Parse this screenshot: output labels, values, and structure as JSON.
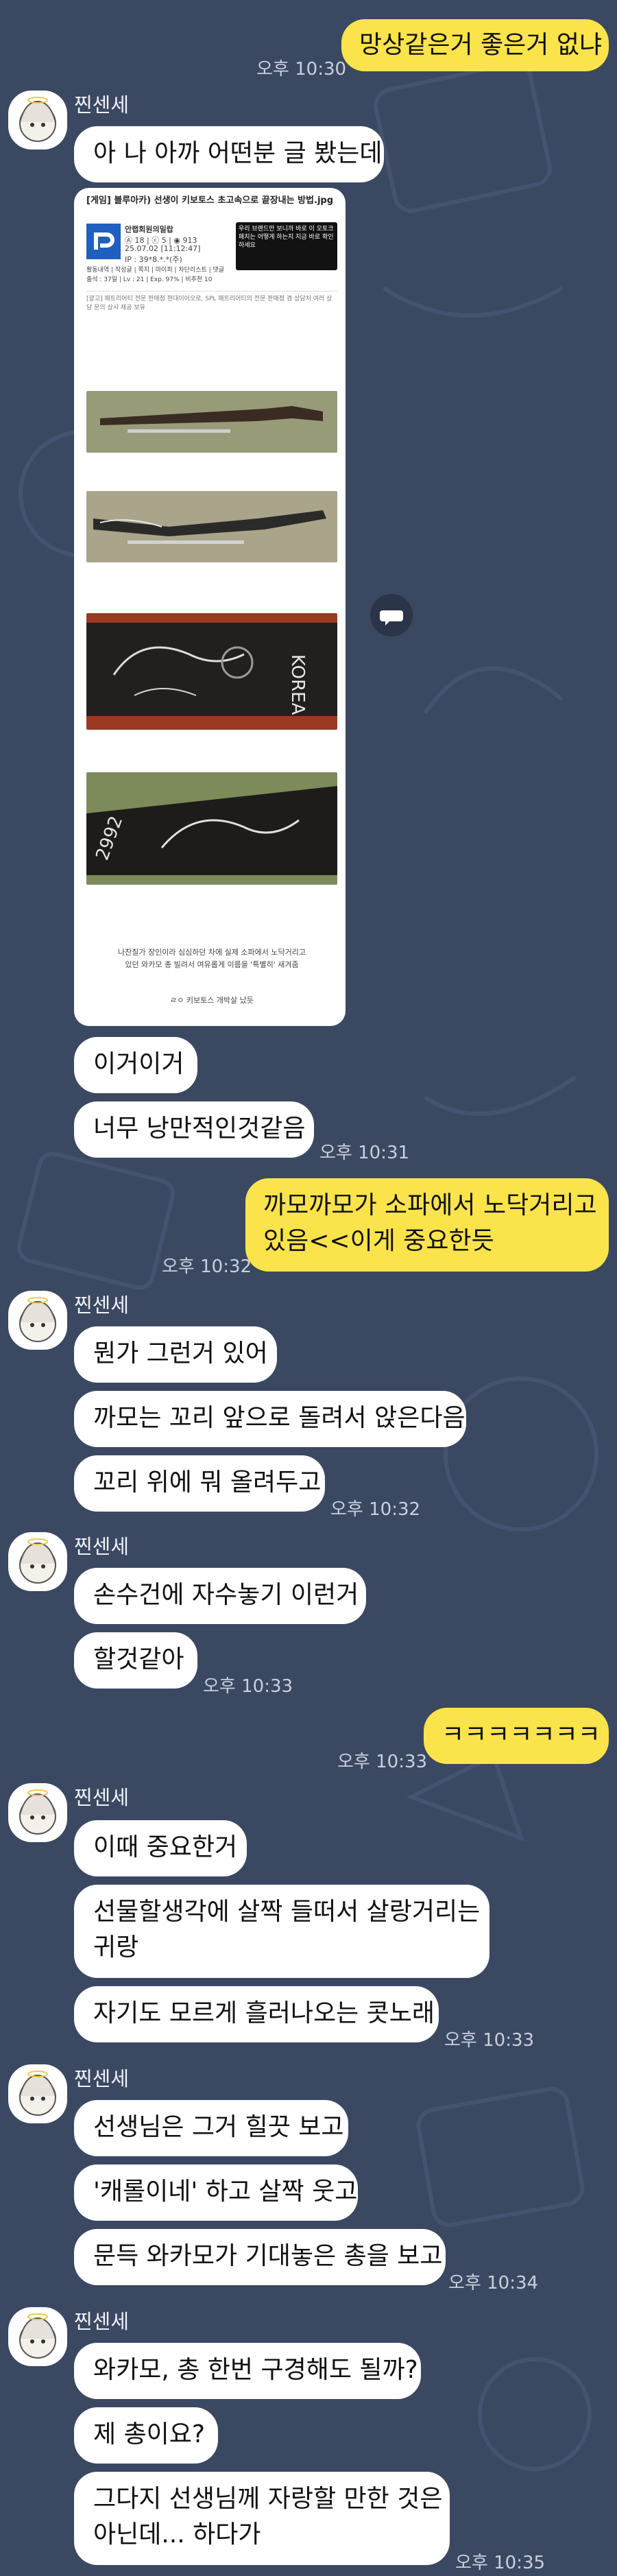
{
  "chat": {
    "contact_name": "찐센세",
    "colors": {
      "background": "#3b4862",
      "incoming": "#ffffff",
      "outgoing": "#fbe34c"
    }
  },
  "messages": [
    {
      "dir": "out",
      "text": "망상같은거 좋은거 없냐",
      "time": "오후 10:30"
    },
    {
      "dir": "in",
      "text": "아 나 아까 어떤분 글 봤는데"
    },
    {
      "dir": "in",
      "kind": "image"
    },
    {
      "dir": "in",
      "text": "이거이거"
    },
    {
      "dir": "in",
      "text": "너무 낭만적인것같음",
      "time": "오후 10:31"
    },
    {
      "dir": "out",
      "text": "까모까모가 소파에서 노닥거리고\n있음<<이게 중요한듯",
      "time": "오후 10:32"
    },
    {
      "dir": "in",
      "text": "뭔가 그런거 있어"
    },
    {
      "dir": "in",
      "text": "까모는 꼬리 앞으로 돌려서 앉은다음"
    },
    {
      "dir": "in",
      "text": "꼬리 위에 뭐 올려두고",
      "time": "오후 10:32"
    },
    {
      "dir": "in",
      "text": "손수건에 자수놓기 이런거"
    },
    {
      "dir": "in",
      "text": "할것같아",
      "time": "오후 10:33"
    },
    {
      "dir": "out",
      "text": "ㅋㅋㅋㅋㅋㅋㅋ",
      "time": "오후 10:33"
    },
    {
      "dir": "in",
      "text": "이때 중요한거"
    },
    {
      "dir": "in",
      "text": "선물할생각에 살짝 들떠서 살랑거리는\n귀랑"
    },
    {
      "dir": "in",
      "text": "자기도 모르게 흘러나오는 콧노래",
      "time": "오후 10:33"
    },
    {
      "dir": "in",
      "text": "선생님은 그거 힐끗 보고"
    },
    {
      "dir": "in",
      "text": "'캐롤이네' 하고 살짝 웃고"
    },
    {
      "dir": "in",
      "text": "문득 와카모가 기대놓은 총을 보고",
      "time": "오후 10:34"
    },
    {
      "dir": "in",
      "text": "와카모, 총 한번 구경해도 될까?"
    },
    {
      "dir": "in",
      "text": "제 총이요?"
    },
    {
      "dir": "in",
      "text": "그다지 선생님께 자랑할 만한 것은\n아닌데... 하다가",
      "time": "오후 10:35"
    }
  ],
  "shared_post": {
    "title": "[게임] 블루아카) 선생이 키보토스 초고속으로 끝장내는 방법.jpg",
    "author": "안랩회원의밀랍",
    "meta": "Ⓐ 18 | ⓒ 5 | ◉ 913",
    "date": "25.07.02 [11:12:47]",
    "ip": "IP : 39*8.*.*(주)",
    "stats_line1": "활동내역 | 작성글 | 쪽지 | 마이피 | 차단리스트 | 댓글",
    "stats_line2": "출석 : 37일 | Lv : 21 | Exp. 97% | 비추천 10",
    "ad_text": "[광고] 패트리어티 전문 판매점 현대이어오로, SPL 패트리어티의 전문 판매점 겸 상담처 여러 상담 문의 상시 제공 보유",
    "side_ad": "우리 브랜드만 보니까 바로 이 오토크 패치는 어떻게 하는지 지금 바로 확인 하세요",
    "caption_line1": "나찬칠가 장인이라 심심하던 차에 실제 소파에서 노닥거리고",
    "caption_line2": "있던 와카모 총 빌려서 여유롭게 이름을 '특별히' 새겨줌",
    "footer": "ㄹㅇ 키보토스 개박살 났듯",
    "stamp": "KOREA",
    "rifle_number": "2992"
  }
}
